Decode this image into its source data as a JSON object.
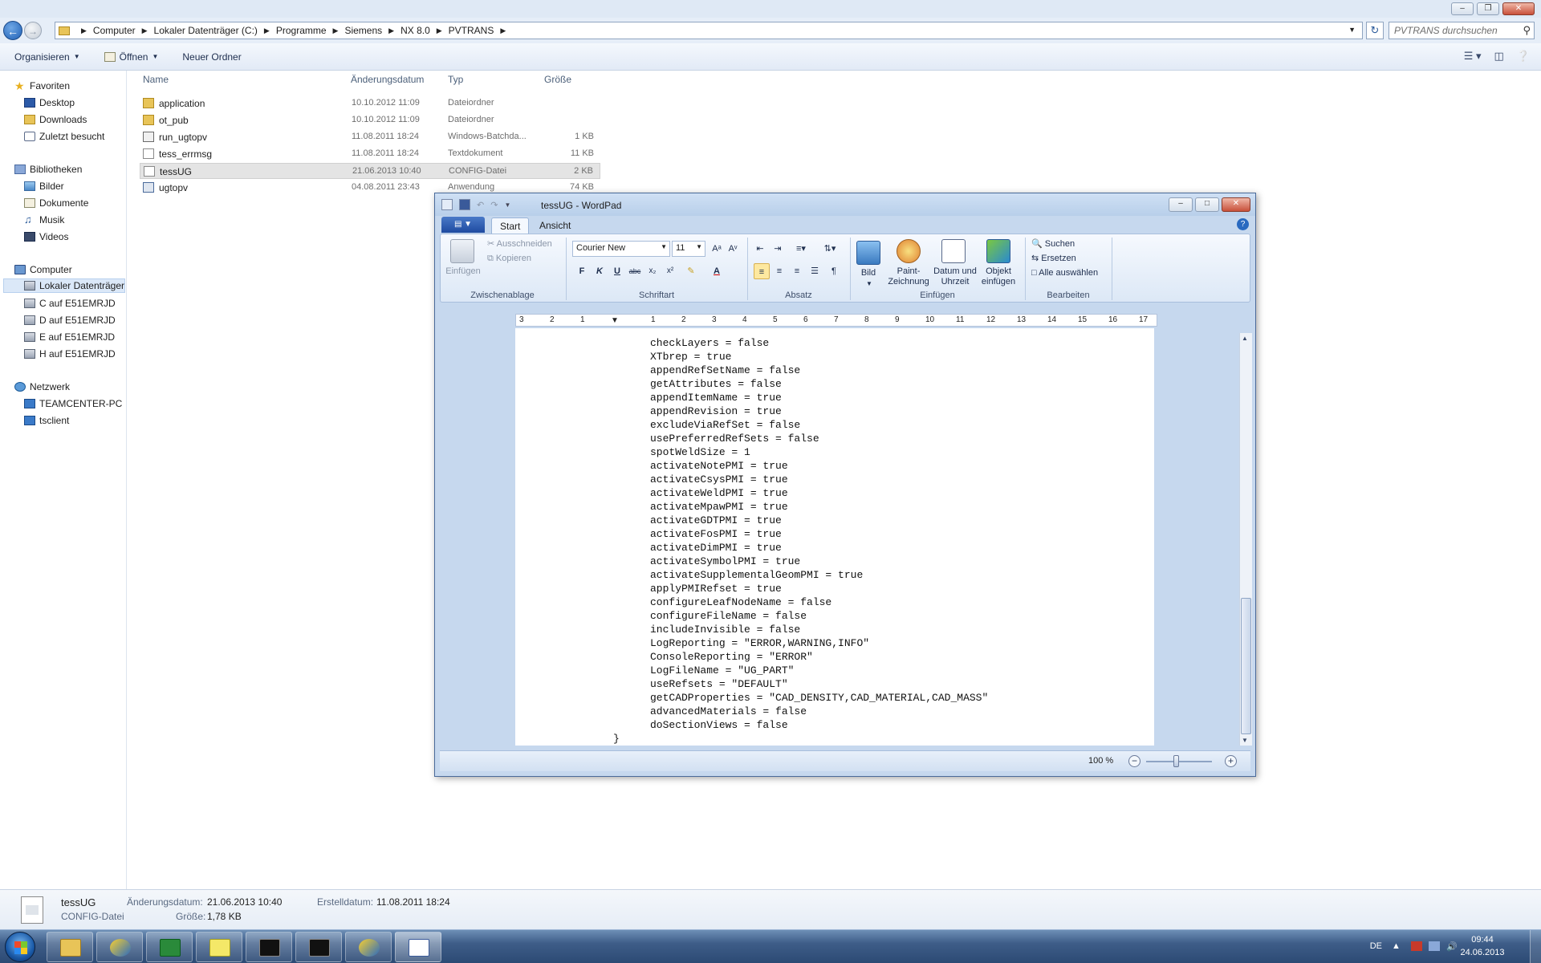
{
  "explorer": {
    "breadcrumb": [
      "Computer",
      "Lokaler Datenträger (C:)",
      "Programme",
      "Siemens",
      "NX 8.0",
      "PVTRANS"
    ],
    "search_placeholder": "PVTRANS durchsuchen",
    "commands": {
      "organize": "Organisieren",
      "open": "Öffnen",
      "new_folder": "Neuer Ordner"
    },
    "columns": {
      "name": "Name",
      "date": "Änderungsdatum",
      "type": "Typ",
      "size": "Größe"
    },
    "files": [
      {
        "name": "application",
        "date": "10.10.2012 11:09",
        "type": "Dateiordner",
        "size": "",
        "icon": "folder-icon"
      },
      {
        "name": "ot_pub",
        "date": "10.10.2012 11:09",
        "type": "Dateiordner",
        "size": "",
        "icon": "folder-icon"
      },
      {
        "name": "run_ugtopv",
        "date": "11.08.2011 18:24",
        "type": "Windows-Batchda...",
        "size": "1 KB",
        "icon": "batch-file-icon"
      },
      {
        "name": "tess_errmsg",
        "date": "11.08.2011 18:24",
        "type": "Textdokument",
        "size": "11 KB",
        "icon": "text-file-icon"
      },
      {
        "name": "tessUG",
        "date": "21.06.2013 10:40",
        "type": "CONFIG-Datei",
        "size": "2 KB",
        "icon": "config-file-icon"
      },
      {
        "name": "ugtopv",
        "date": "04.08.2011 23:43",
        "type": "Anwendung",
        "size": "74 KB",
        "icon": "application-icon"
      }
    ],
    "nav": {
      "favorites": "Favoriten",
      "desktop": "Desktop",
      "downloads": "Downloads",
      "recent": "Zuletzt besucht",
      "libraries": "Bibliotheken",
      "pictures": "Bilder",
      "documents": "Dokumente",
      "music": "Musik",
      "videos": "Videos",
      "computer": "Computer",
      "local_disk": "Lokaler Datenträger",
      "c_drive": "C auf E51EMRJD",
      "d_drive": "D auf E51EMRJD",
      "e_drive": "E auf E51EMRJD",
      "h_drive": "H auf E51EMRJD",
      "network": "Netzwerk",
      "teamcenter": "TEAMCENTER-PC",
      "tsclient": "tsclient"
    },
    "details": {
      "name": "tessUG",
      "type": "CONFIG-Datei",
      "modified_label": "Änderungsdatum:",
      "modified_value": "21.06.2013 10:40",
      "created_label": "Erstelldatum:",
      "created_value": "11.08.2011 18:24",
      "size_label": "Größe:",
      "size_value": "1,78 KB"
    }
  },
  "wordpad": {
    "title": "tessUG - WordPad",
    "tabs": {
      "start": "Start",
      "view": "Ansicht"
    },
    "clipboard": {
      "paste": "Einfügen",
      "cut": "Ausschneiden",
      "copy": "Kopieren",
      "group": "Zwischenablage"
    },
    "font": {
      "family": "Courier New",
      "size": "11",
      "group": "Schriftart",
      "bold": "F",
      "italic": "K",
      "underline": "U"
    },
    "paragraph": {
      "group": "Absatz"
    },
    "insert": {
      "picture": "Bild",
      "paint_line1": "Paint-",
      "paint_line2": "Zeichnung",
      "datetime_line1": "Datum und",
      "datetime_line2": "Uhrzeit",
      "object_line1": "Objekt",
      "object_line2": "einfügen",
      "group": "Einfügen"
    },
    "editing": {
      "find": "Suchen",
      "replace": "Ersetzen",
      "select_all": "Alle auswählen",
      "group": "Bearbeiten"
    },
    "ruler_numbers": [
      "3",
      "2",
      "1",
      "1",
      "2",
      "3",
      "4",
      "5",
      "6",
      "7",
      "8",
      "9",
      "10",
      "11",
      "12",
      "13",
      "14",
      "15",
      "16",
      "17"
    ],
    "lines": [
      "checkLayers = false",
      "XTbrep = true",
      "appendRefSetName = false",
      "getAttributes = false",
      "appendItemName = true",
      "appendRevision = true",
      "excludeViaRefSet = false",
      "usePreferredRefSets = false",
      "spotWeldSize = 1",
      "activateNotePMI = true",
      "activateCsysPMI = true",
      "activateWeldPMI = true",
      "activateMpawPMI = true",
      "activateGDTPMI = true",
      "activateFosPMI = true",
      "activateDimPMI = true",
      "activateSymbolPMI = true",
      "activateSupplementalGeomPMI = true",
      "applyPMIRefset = true",
      "configureLeafNodeName = false",
      "configureFileName = false",
      "includeInvisible = false",
      "LogReporting = \"ERROR,WARNING,INFO\"",
      "ConsoleReporting = \"ERROR\"",
      "LogFileName = \"UG_PART\"",
      "useRefsets = \"DEFAULT\"",
      "getCADProperties = \"CAD_DENSITY,CAD_MATERIAL,CAD_MASS\"",
      "advancedMaterials = false",
      "doSectionViews = false"
    ],
    "closing_brace": "}",
    "zoom": "100 %",
    "zoom_level": 1.0
  },
  "taskbar": {
    "lang": "DE",
    "time": "09:44",
    "date": "24.06.2013"
  }
}
